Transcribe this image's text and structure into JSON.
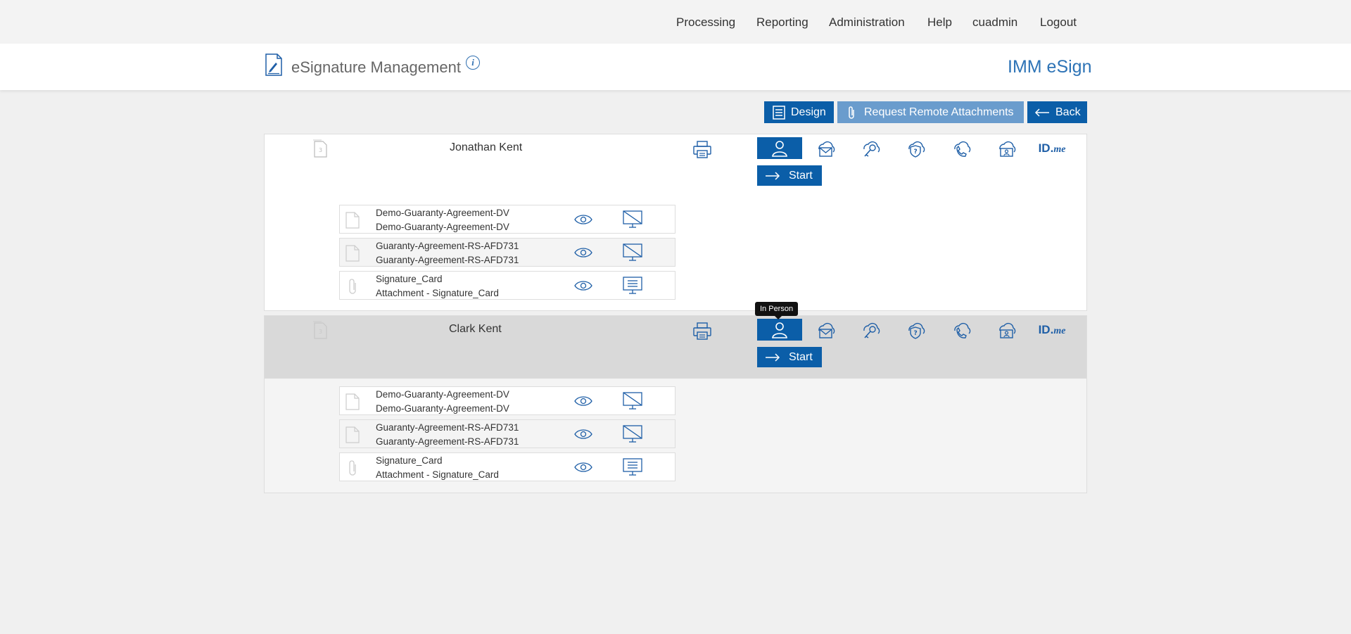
{
  "nav": {
    "processing": "Processing",
    "reporting": "Reporting",
    "administration": "Administration",
    "help": "Help",
    "user": "cuadmin",
    "logout": "Logout"
  },
  "header": {
    "title": "eSignature Management",
    "info": "i",
    "brand": "IMM eSign"
  },
  "actions": {
    "design": "Design",
    "request_remote": "Request Remote Attachments",
    "back": "Back"
  },
  "signers": [
    {
      "name": "Jonathan Kent",
      "active_method": "In Person",
      "start": "Start",
      "documents": [
        {
          "line1": "Demo-Guaranty-Agreement-DV",
          "line2": "Demo-Guaranty-Agreement-DV",
          "type": "document-icon",
          "status": "screen-disabled-icon"
        },
        {
          "line1": "Guaranty-Agreement-RS-AFD731",
          "line2": "Guaranty-Agreement-RS-AFD731",
          "type": "document-icon",
          "status": "screen-disabled-icon"
        },
        {
          "line1": "Signature_Card",
          "line2": "Attachment - Signature_Card",
          "type": "paperclip-icon",
          "status": "screen-enabled-icon"
        }
      ]
    },
    {
      "name": "Clark Kent",
      "active_method": "In Person",
      "start": "Start",
      "tooltip": "In Person",
      "documents": [
        {
          "line1": "Demo-Guaranty-Agreement-DV",
          "line2": "Demo-Guaranty-Agreement-DV",
          "type": "document-icon",
          "status": "screen-disabled-icon"
        },
        {
          "line1": "Guaranty-Agreement-RS-AFD731",
          "line2": "Guaranty-Agreement-RS-AFD731",
          "type": "document-icon",
          "status": "screen-disabled-icon"
        },
        {
          "line1": "Signature_Card",
          "line2": "Attachment - Signature_Card",
          "type": "paperclip-icon",
          "status": "screen-enabled-icon"
        }
      ]
    }
  ],
  "methods": {
    "idme_prefix": "ID.",
    "idme_suffix": "me"
  },
  "colors": {
    "primary": "#0b5ea8",
    "primary_light": "#6a9ccd",
    "brand_text": "#2d73b6",
    "icon_blue": "#1f5fa7"
  }
}
